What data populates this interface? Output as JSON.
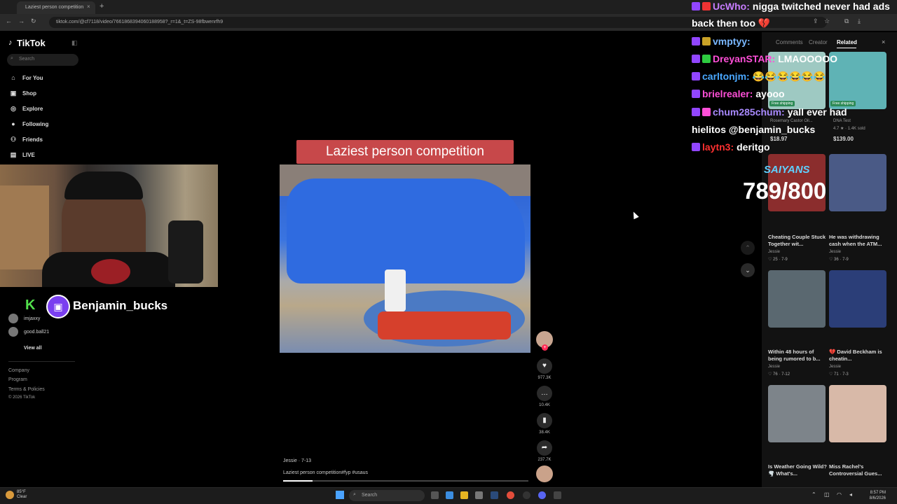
{
  "browser": {
    "tab_title": "Laziest person competition",
    "tab_close": "×",
    "new_tab": "+",
    "url": "tiktok.com/@cf7118/video/7661868394060188958?_r=1&_t=ZS-98fbwenrfh9",
    "nav_icons": [
      "back-icon",
      "forward-icon",
      "reload-icon"
    ]
  },
  "sidebar": {
    "logo": "TikTok",
    "search_placeholder": "Search",
    "items": [
      {
        "label": "For You",
        "icon": "home-icon"
      },
      {
        "label": "Shop",
        "icon": "shop-icon"
      },
      {
        "label": "Explore",
        "icon": "compass-icon"
      },
      {
        "label": "Following",
        "icon": "following-icon"
      },
      {
        "label": "Friends",
        "icon": "friends-icon"
      },
      {
        "label": "LIVE",
        "icon": "live-icon"
      }
    ],
    "following_accounts": [
      {
        "name": "imjaxxy",
        "handle": "imjaxxy"
      },
      {
        "name": "good.ball21",
        "handle": "good.ball21"
      }
    ],
    "view_all": "View all",
    "footer": [
      "Company",
      "Program",
      "Terms & Policies",
      "© 2026 TikTok"
    ]
  },
  "stream_overlay": {
    "streamer_name": "Benjamin_bucks",
    "platform_badge": "K",
    "chat": [
      {
        "user": "UcWho:",
        "message": "nigga twitched never had ads",
        "user_color": "#c77dff"
      },
      {
        "user": "",
        "message": "back then too 💔",
        "user_color": "#ffffff"
      },
      {
        "user": "vmptyy:",
        "message": "",
        "user_color": "#7ab8ff"
      },
      {
        "user": "DreyanSTAR:",
        "message": "LMAOOOOO",
        "user_color": "#ff4fd8"
      },
      {
        "user": "carltonjm:",
        "message": "😂😂😂😂😂😂",
        "user_color": "#4aa8ff"
      },
      {
        "user": "brielrealer:",
        "message": "ayooo",
        "user_color": "#ff4fd8"
      },
      {
        "user": "chum285chum:",
        "message": "yall ever had",
        "user_color": "#a98aff"
      },
      {
        "user": "",
        "message": "hielitos @benjamin_bucks",
        "user_color": "#ffffff"
      },
      {
        "user": "laytn3:",
        "message": "deritgo",
        "user_color": "#ff3030"
      }
    ],
    "sub_goal_label": "SAIYANS",
    "sub_goal": "789/800"
  },
  "video": {
    "title_overlay": "Laziest person competition",
    "author": "Jessie · 7-13",
    "description": "Laziest person competition#fyp #usaus",
    "progress": 0.12,
    "likes": "977.3K",
    "comments": "10.4K",
    "saves": "38.4K",
    "shares": "237.7K"
  },
  "right_panel": {
    "tabs": [
      "Comments",
      "Creator",
      "Related"
    ],
    "close": "×",
    "products": [
      {
        "name": "Rosemary Castor Oil...",
        "price": "$18.97",
        "badge": "Free shipping"
      },
      {
        "name": "DNA Test",
        "price": "$139.00",
        "rating": "4.7 ★ · 1.4K sold",
        "badge": "Free shipping"
      }
    ],
    "related": [
      {
        "title": "Cheating Couple Stuck Together wit...",
        "author": "Jessie",
        "likes": "25",
        "date": "7-9",
        "thumb_color": "#8b2d2d"
      },
      {
        "title": "He was withdrawing cash when the ATM...",
        "author": "Jessie",
        "likes": "36",
        "date": "7-9",
        "thumb_color": "#4a5a86"
      },
      {
        "title": "Within 48 hours of being rumored to b...",
        "author": "Jessie",
        "likes": "76",
        "date": "7-12",
        "thumb_color": "#5a6870"
      },
      {
        "title": "💔 David Beckham is cheatin...",
        "author": "Jessie",
        "likes": "71",
        "date": "7-3",
        "thumb_color": "#2b3e78"
      },
      {
        "title": "Is Weather Going Wild? 🌪️ What's...",
        "author": "",
        "likes": "",
        "date": "",
        "thumb_color": "#7d848a"
      },
      {
        "title": "Miss Rachel's Controversial Gues...",
        "author": "",
        "likes": "",
        "date": "",
        "thumb_color": "#d8b9a8"
      }
    ]
  },
  "taskbar": {
    "weather_temp": "85°F",
    "weather_desc": "Clear",
    "search": "Search",
    "time": "8:57 PM",
    "date": "8/6/2026"
  }
}
